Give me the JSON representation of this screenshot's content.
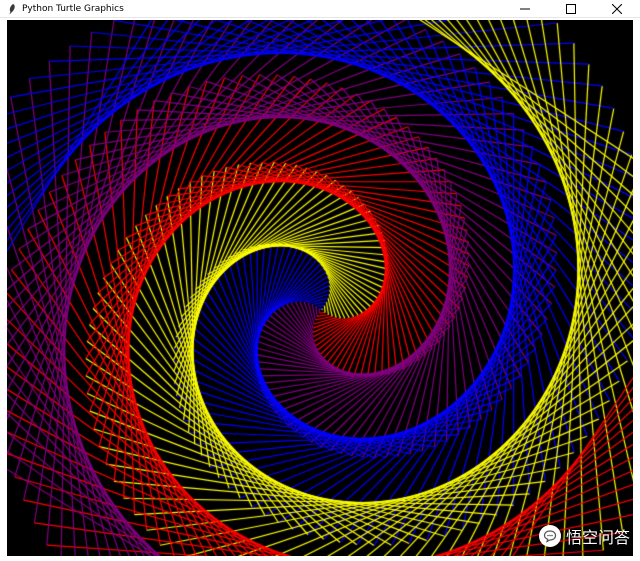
{
  "window": {
    "title": "Python Turtle Graphics",
    "minimize_icon": "minimize-icon",
    "maximize_icon": "maximize-icon",
    "close_icon": "close-icon"
  },
  "canvas": {
    "background": "#000000",
    "pen_colors": [
      "#ff0000",
      "#ffff00",
      "#0000ff",
      "#800080"
    ]
  },
  "watermark": {
    "text": "悟空问答",
    "icon": "chat-bubble-icon"
  }
}
